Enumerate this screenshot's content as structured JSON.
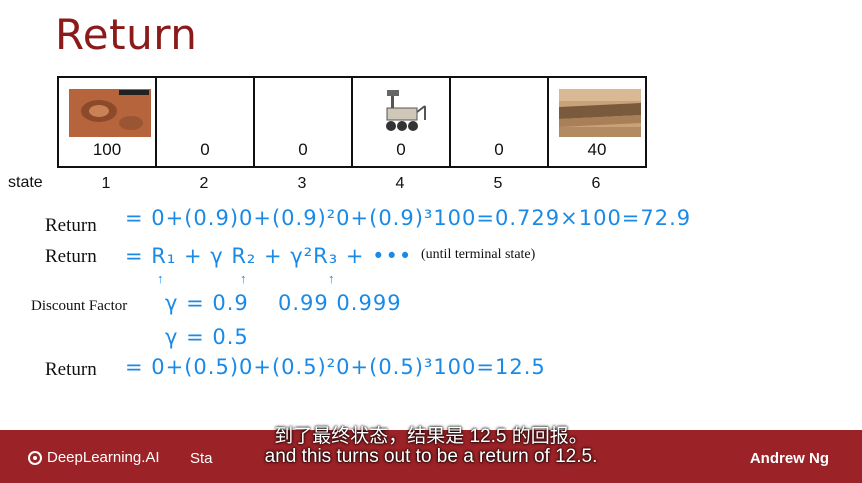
{
  "slide": {
    "title": "Return",
    "state_label": "state",
    "rewards": [
      "100",
      "0",
      "0",
      "0",
      "0",
      "40"
    ],
    "states": [
      "1",
      "2",
      "3",
      "4",
      "5",
      "6"
    ],
    "row_labels": {
      "return1": "Return",
      "return2": "Return",
      "discount": "Discount Factor",
      "return3": "Return"
    },
    "equations": {
      "eq1": "= 0+(0.9)0+(0.9)²0+(0.9)³100=0.729×100=72.9",
      "eq2": "= R₁ + γ R₂ + γ²R₃ + •••",
      "gamma1": "γ = 0.9",
      "gamma_alts": "0.99  0.999",
      "gamma2": "γ = 0.5",
      "eq3": "= 0+(0.5)0+(0.5)²0+(0.5)³100=12.5"
    },
    "note": "(until terminal state)"
  },
  "footer": {
    "brand": "DeepLearning.AI",
    "stage": "Sta",
    "author": "Andrew Ng"
  },
  "subtitles": {
    "zh": "到了最终状态，结果是 12.5 的回报。",
    "en": "and this turns out to be a return of 12.5."
  },
  "colors": {
    "title": "#8b1a1a",
    "handwriting": "#1a8ae6",
    "footer": "#9b2226"
  }
}
